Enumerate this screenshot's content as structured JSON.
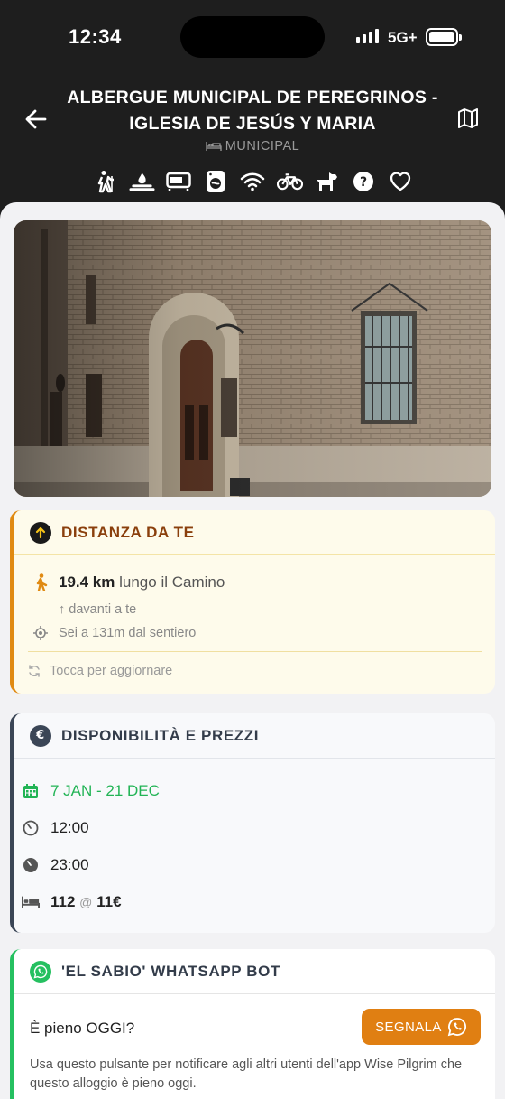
{
  "status_bar": {
    "time": "12:34",
    "network": "5G+"
  },
  "header": {
    "title": "ALBERGUE MUNICIPAL DE PEREGRINOS - IGLESIA DE JESÚS Y MARIA",
    "type": "MUNICIPAL",
    "amenities": [
      "pilgrim-icon",
      "campfire-icon",
      "microwave-icon",
      "washing-machine-icon",
      "wifi-icon",
      "bicycle-icon",
      "dog-icon",
      "question-icon",
      "heart-icon"
    ]
  },
  "photo": {
    "alt_icon": "church-facade-photo"
  },
  "distance": {
    "title": "DISTANZA DA TE",
    "value": "19.4 km",
    "suffix": "lungo il Camino",
    "direction": "↑ davanti a te",
    "trail_distance": "Sei a 131m dal sentiero",
    "refresh": "Tocca per aggiornare"
  },
  "availability": {
    "title": "DISPONIBILITÀ E PREZZI",
    "dates": "7 JAN - 21 DEC",
    "open_time": "12:00",
    "close_time": "23:00",
    "beds": "112",
    "at": "@",
    "price": "11€"
  },
  "bot": {
    "title": "'EL SABIO' WHATSAPP BOT",
    "question": "È pieno OGGI?",
    "button": "SEGNALA",
    "note": "Usa questo pulsante per notificare agli altri utenti dell'app Wise Pilgrim che questo alloggio è pieno oggi."
  },
  "colors": {
    "accent_orange": "#e07f12",
    "accent_green": "#25c060",
    "dark": "#1e1e1e"
  }
}
